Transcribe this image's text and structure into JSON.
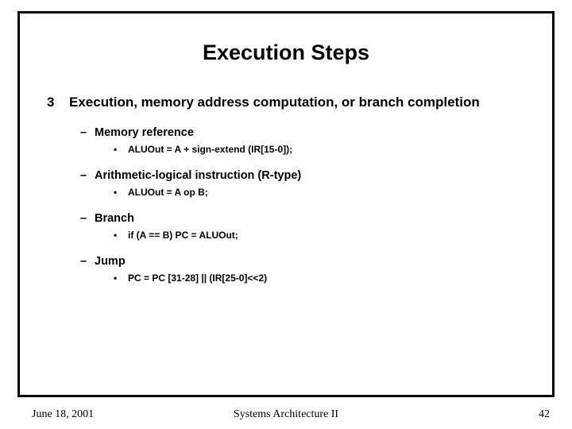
{
  "title": "Execution Steps",
  "step": {
    "number": "3",
    "text": "Execution, memory address computation, or branch completion"
  },
  "subs": {
    "memref": {
      "label": "Memory reference",
      "detail": "ALUOut = A + sign-extend (IR[15-0]);"
    },
    "arith": {
      "label": "Arithmetic-logical instruction (R-type)",
      "detail": "ALUOut = A op B;"
    },
    "branch": {
      "label": "Branch",
      "detail": "if (A == B) PC = ALUOut;"
    },
    "jump": {
      "label": "Jump",
      "detail": "PC = PC [31-28] || (IR[25-0]<<2)"
    }
  },
  "footer": {
    "date": "June 18, 2001",
    "center": "Systems Architecture II",
    "page": "42"
  }
}
